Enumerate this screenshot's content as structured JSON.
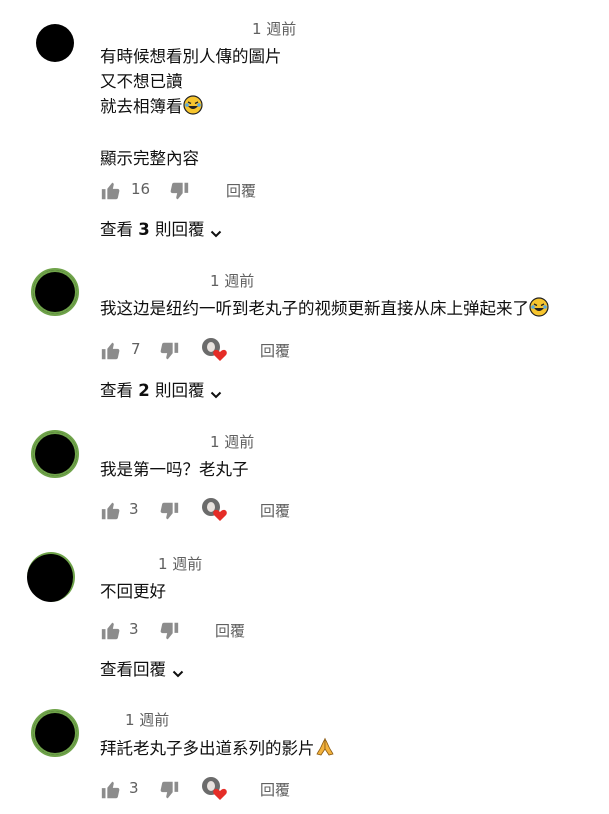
{
  "comments": [
    {
      "time": "1 週前",
      "lines": [
        "有時候想看別人傳的圖片",
        "又不想已讀",
        "就去相簿看"
      ],
      "show_more": "顯示完整內容",
      "likes": "16",
      "reply_label": "回覆",
      "view_replies": {
        "prefix": "查看 ",
        "count": "3",
        "suffix": " 則回覆"
      }
    },
    {
      "time": "1 週前",
      "lines": [
        "我这边是纽约一听到老丸子的视频更新直接从床上弹起来了"
      ],
      "likes": "7",
      "reply_label": "回覆",
      "view_replies": {
        "prefix": "查看 ",
        "count": "2",
        "suffix": " 則回覆"
      }
    },
    {
      "time": "1 週前",
      "lines": [
        "我是第一吗？老丸子"
      ],
      "likes": "3",
      "reply_label": "回覆"
    },
    {
      "time": "1 週前",
      "lines": [
        "不回更好"
      ],
      "likes": "3",
      "reply_label": "回覆",
      "view_replies_plain": "查看回覆"
    },
    {
      "time": "1 週前",
      "lines": [
        "拜託老丸子多出道系列的影片"
      ],
      "likes": "3",
      "reply_label": "回覆"
    }
  ],
  "icons": {
    "like": "thumbs-up-icon",
    "dislike": "thumbs-down-icon",
    "expand": "chevron-down-icon",
    "creator_heart": "creator-heart-icon"
  },
  "colors": {
    "text": "#0f0f0f",
    "secondary": "#606060",
    "heart": "#e52d27",
    "avatar_ring": "#6fa34a"
  }
}
